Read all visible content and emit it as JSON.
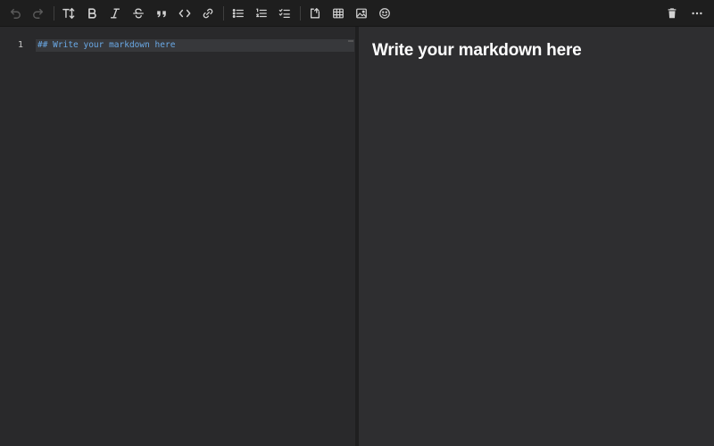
{
  "toolbar": {
    "buttons": [
      {
        "id": "undo",
        "icon": "undo-icon"
      },
      {
        "id": "redo",
        "icon": "redo-icon"
      },
      {
        "id": "heading",
        "icon": "text-size-icon"
      },
      {
        "id": "bold",
        "icon": "bold-icon"
      },
      {
        "id": "italic",
        "icon": "italic-icon"
      },
      {
        "id": "strikethrough",
        "icon": "strikethrough-icon"
      },
      {
        "id": "quote",
        "icon": "quote-icon"
      },
      {
        "id": "code",
        "icon": "code-icon"
      },
      {
        "id": "link",
        "icon": "link-icon"
      },
      {
        "id": "bullet-list",
        "icon": "bullet-list-icon"
      },
      {
        "id": "numbered-list",
        "icon": "numbered-list-icon"
      },
      {
        "id": "task-list",
        "icon": "checklist-icon"
      },
      {
        "id": "insert-block",
        "icon": "insert-block-icon"
      },
      {
        "id": "table",
        "icon": "table-icon"
      },
      {
        "id": "image",
        "icon": "image-icon"
      },
      {
        "id": "emoji",
        "icon": "emoji-icon"
      },
      {
        "id": "delete",
        "icon": "trash-icon"
      },
      {
        "id": "more",
        "icon": "more-icon"
      }
    ]
  },
  "editor": {
    "line_number": "1",
    "line_text": "## Write your markdown here"
  },
  "preview": {
    "heading": "Write your markdown here"
  }
}
